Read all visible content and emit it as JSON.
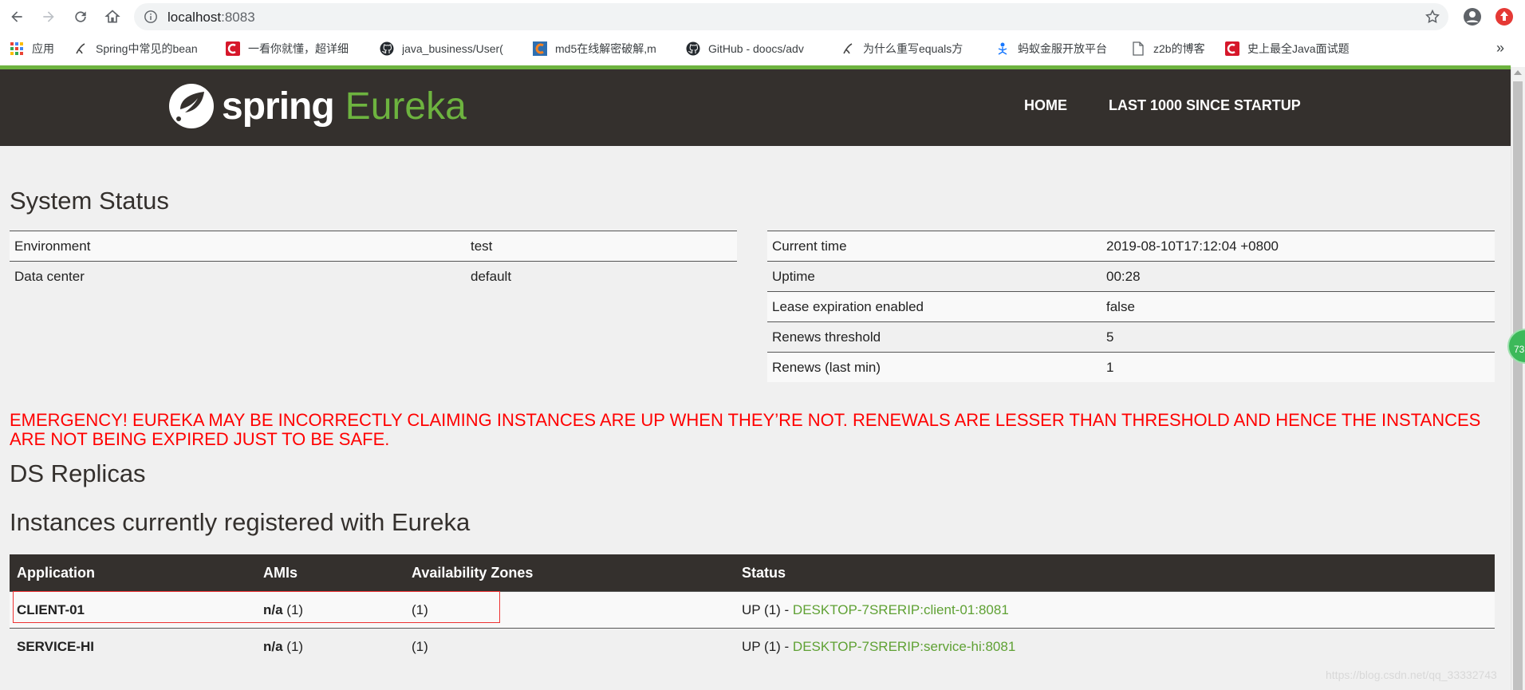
{
  "browser": {
    "url_host": "localhost",
    "url_port": ":8083",
    "bookmarks": [
      {
        "label": "应用",
        "icon": "apps-grid-icon"
      },
      {
        "label": "Spring中常见的bean",
        "icon": "bean-icon"
      },
      {
        "label": "一看你就懂，超详细",
        "icon": "csdn-icon"
      },
      {
        "label": "java_business/User(",
        "icon": "github-icon"
      },
      {
        "label": "md5在线解密破解,m",
        "icon": "cmd5-icon"
      },
      {
        "label": "GitHub - doocs/adv",
        "icon": "github-icon"
      },
      {
        "label": "为什么重写equals方",
        "icon": "bean-icon"
      },
      {
        "label": "蚂蚁金服开放平台",
        "icon": "ant-icon"
      },
      {
        "label": "z2b的博客",
        "icon": "page-icon"
      },
      {
        "label": "史上最全Java面试题",
        "icon": "csdn-icon"
      }
    ],
    "more": "»",
    "badge": "73"
  },
  "header": {
    "brand_spring": "spring",
    "brand_eureka": "Eureka",
    "nav_home": "HOME",
    "nav_last": "LAST 1000 SINCE STARTUP"
  },
  "system_status": {
    "title": "System Status",
    "left": [
      {
        "label": "Environment",
        "value": "test"
      },
      {
        "label": "Data center",
        "value": "default"
      }
    ],
    "right": [
      {
        "label": "Current time",
        "value": "2019-08-10T17:12:04 +0800"
      },
      {
        "label": "Uptime",
        "value": "00:28"
      },
      {
        "label": "Lease expiration enabled",
        "value": "false"
      },
      {
        "label": "Renews threshold",
        "value": "5"
      },
      {
        "label": "Renews (last min)",
        "value": "1"
      }
    ]
  },
  "emergency": "EMERGENCY! EUREKA MAY BE INCORRECTLY CLAIMING INSTANCES ARE UP WHEN THEY’RE NOT. RENEWALS ARE LESSER THAN THRESHOLD AND HENCE THE INSTANCES ARE NOT BEING EXPIRED JUST TO BE SAFE.",
  "ds_replicas": "DS Replicas",
  "instances": {
    "title": "Instances currently registered with Eureka",
    "columns": [
      "Application",
      "AMIs",
      "Availability Zones",
      "Status"
    ],
    "rows": [
      {
        "app": "CLIENT-01",
        "amis": "n/a",
        "amis_count": "(1)",
        "zones": "(1)",
        "status": "UP (1) - ",
        "link": "DESKTOP-7SRERIP:client-01:8081"
      },
      {
        "app": "SERVICE-HI",
        "amis": "n/a",
        "amis_count": "(1)",
        "zones": "(1)",
        "status": "UP (1) - ",
        "link": "DESKTOP-7SRERIP:service-hi:8081"
      }
    ]
  },
  "watermark": "https://blog.csdn.net/qq_33332743",
  "colors": {
    "brand_green": "#6db33f",
    "header_bg": "#34302d",
    "emergency_red": "#ff0000",
    "link_green": "#5fa134"
  }
}
